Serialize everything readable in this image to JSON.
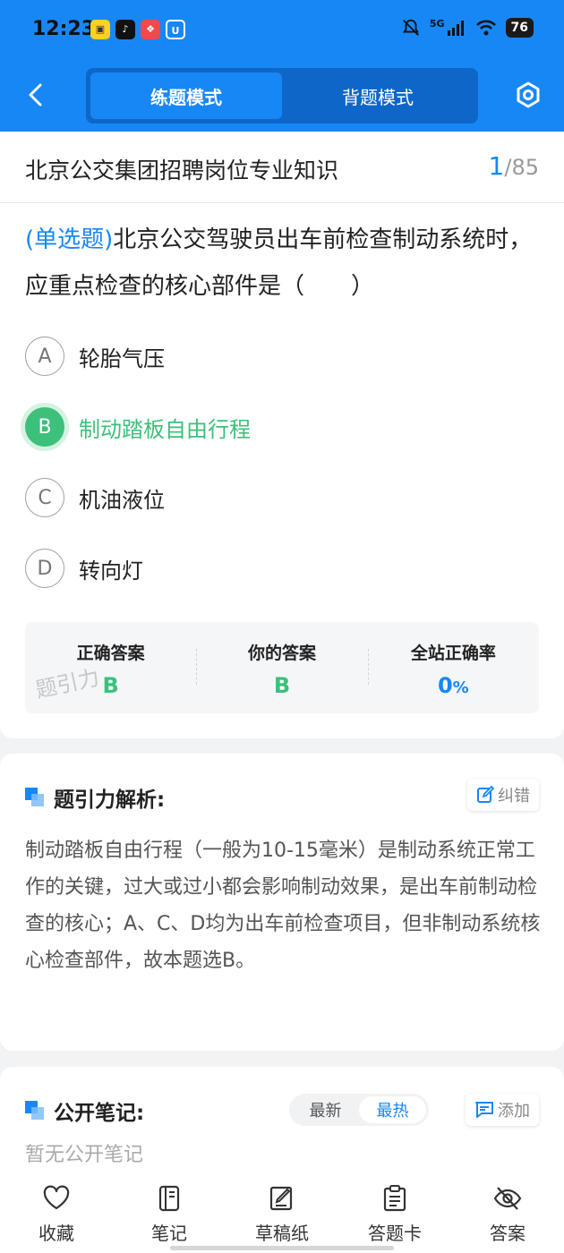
{
  "status_bar": {
    "time": "12:23",
    "network": "5G",
    "battery": "76"
  },
  "header": {
    "tabs": [
      {
        "label": "练题模式",
        "active": true
      },
      {
        "label": "背题模式",
        "active": false
      }
    ]
  },
  "question_header": {
    "title": "北京公交集团招聘岗位专业知识",
    "current": "1",
    "total": "/85"
  },
  "question": {
    "type_label": "(单选题)",
    "text": "北京公交驾驶员出车前检查制动系统时，应重点检查的核心部件是（　　）",
    "options": [
      {
        "letter": "A",
        "text": "轮胎气压"
      },
      {
        "letter": "B",
        "text": "制动踏板自由行程"
      },
      {
        "letter": "C",
        "text": "机油液位"
      },
      {
        "letter": "D",
        "text": "转向灯"
      }
    ]
  },
  "answers": {
    "correct_label": "正确答案",
    "correct_value": "B",
    "yours_label": "你的答案",
    "yours_value": "B",
    "rate_label": "全站正确率",
    "rate_value": "0",
    "rate_unit": "%",
    "watermark": "题引力"
  },
  "analysis": {
    "title": "题引力解析:",
    "report_label": "纠错",
    "text": "制动踏板自由行程（一般为10-15毫米）是制动系统正常工作的关键，过大或过小都会影响制动效果，是出车前制动检查的核心；A、C、D均为出车前检查项目，但非制动系统核心检查部件，故本题选B。"
  },
  "notes": {
    "title": "公开笔记:",
    "sort_newest": "最新",
    "sort_hottest": "最热",
    "add_label": "添加",
    "empty_text": "暂无公开笔记"
  },
  "bottom_bar": {
    "items": [
      {
        "label": "收藏",
        "icon": "heart-icon"
      },
      {
        "label": "笔记",
        "icon": "notebook-icon"
      },
      {
        "label": "草稿纸",
        "icon": "draft-icon"
      },
      {
        "label": "答题卡",
        "icon": "clipboard-icon"
      },
      {
        "label": "答案",
        "icon": "eye-off-icon"
      }
    ]
  },
  "colors": {
    "primary": "#1787f5",
    "correct": "#3cc07a"
  }
}
